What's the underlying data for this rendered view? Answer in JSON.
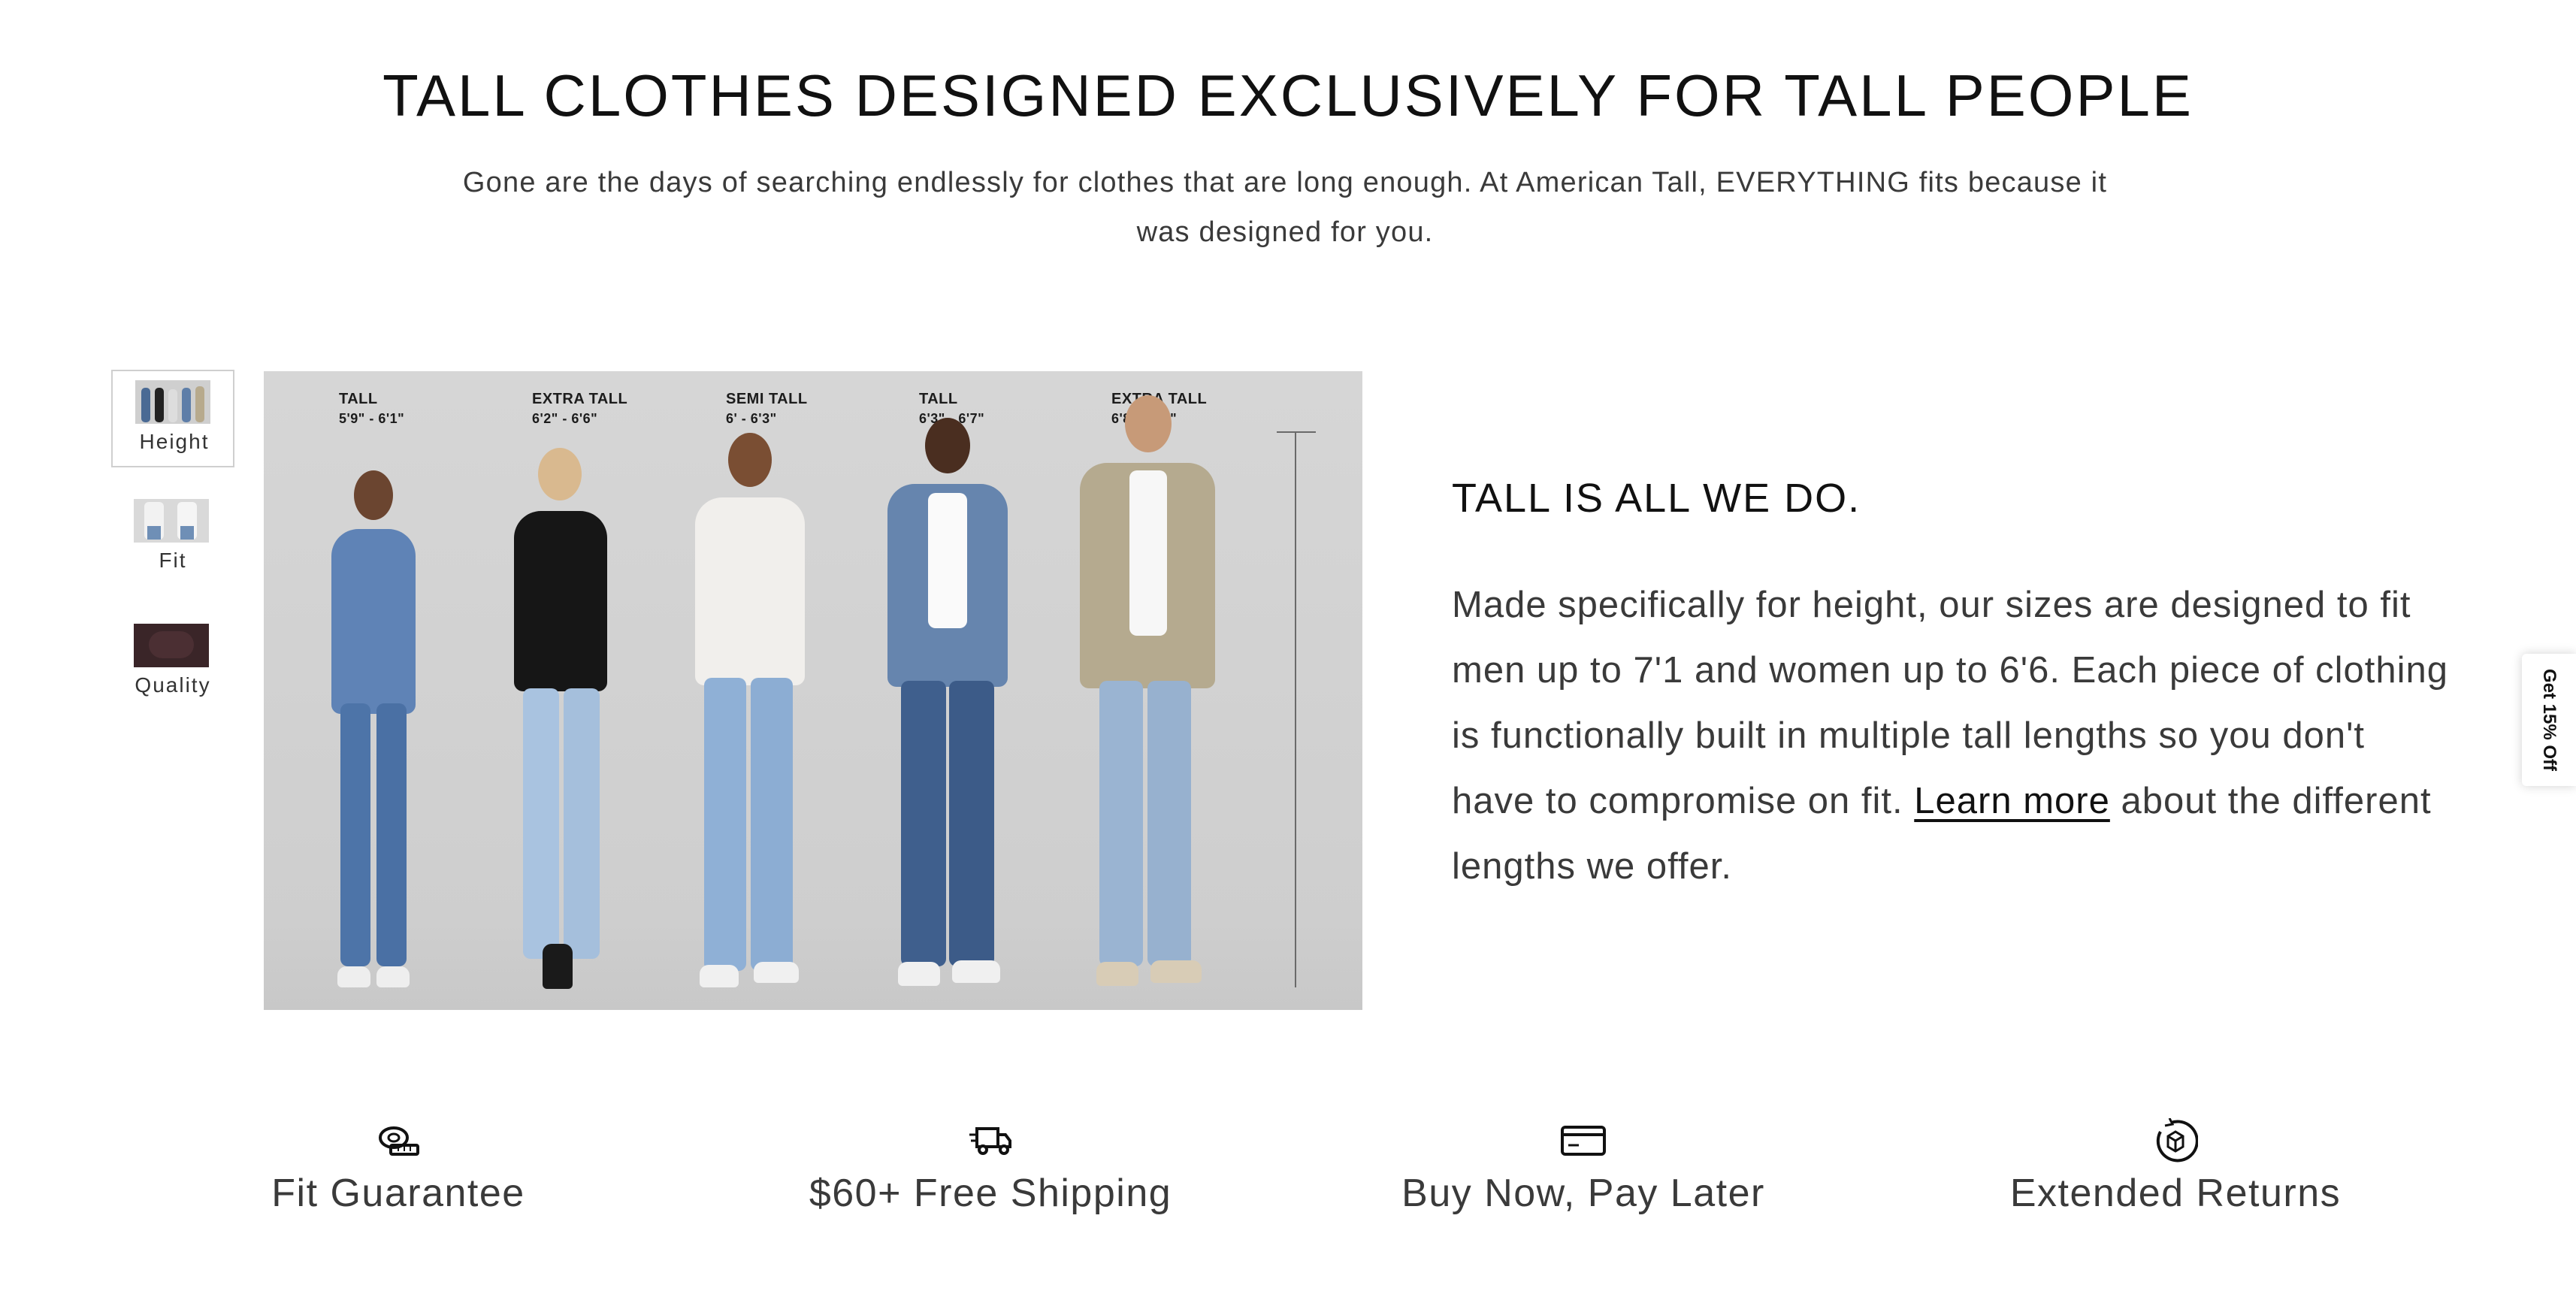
{
  "header": {
    "title": "TALL CLOTHES DESIGNED EXCLUSIVELY FOR TALL PEOPLE",
    "subtitle": "Gone are the days of searching endlessly for clothes that are long enough. At American Tall, EVERYTHING fits because it was designed for you."
  },
  "gallery": {
    "thumbnails": [
      {
        "label": "Height",
        "active": true
      },
      {
        "label": "Fit",
        "active": false
      },
      {
        "label": "Quality",
        "active": false
      }
    ],
    "sizes": [
      {
        "name": "TALL",
        "range": "5'9\" - 6'1\""
      },
      {
        "name": "EXTRA TALL",
        "range": "6'2\" - 6'6\""
      },
      {
        "name": "SEMI TALL",
        "range": "6' - 6'3\""
      },
      {
        "name": "TALL",
        "range": "6'3\" - 6'7\""
      },
      {
        "name": "EXTRA TALL",
        "range": "6'8\" - 7'1\""
      }
    ]
  },
  "about": {
    "tagline": "TALL IS ALL WE DO.",
    "desc_before": "Made specifically for height, our sizes are designed to fit men up to 7'1 and women up to 6'6. Each piece of clothing is functionally built in multiple tall lengths so you don't have to compromise on fit. ",
    "link": "Learn more",
    "desc_after": " about the different lengths we offer."
  },
  "side_tab": {
    "label": "Get 15% Off"
  },
  "features": [
    {
      "label": "Fit Guarantee",
      "icon": "measuring-tape-icon"
    },
    {
      "label": "$60+ Free Shipping",
      "icon": "delivery-truck-icon"
    },
    {
      "label": "Buy Now, Pay Later",
      "icon": "credit-card-icon"
    },
    {
      "label": "Extended Returns",
      "icon": "return-box-icon"
    }
  ]
}
